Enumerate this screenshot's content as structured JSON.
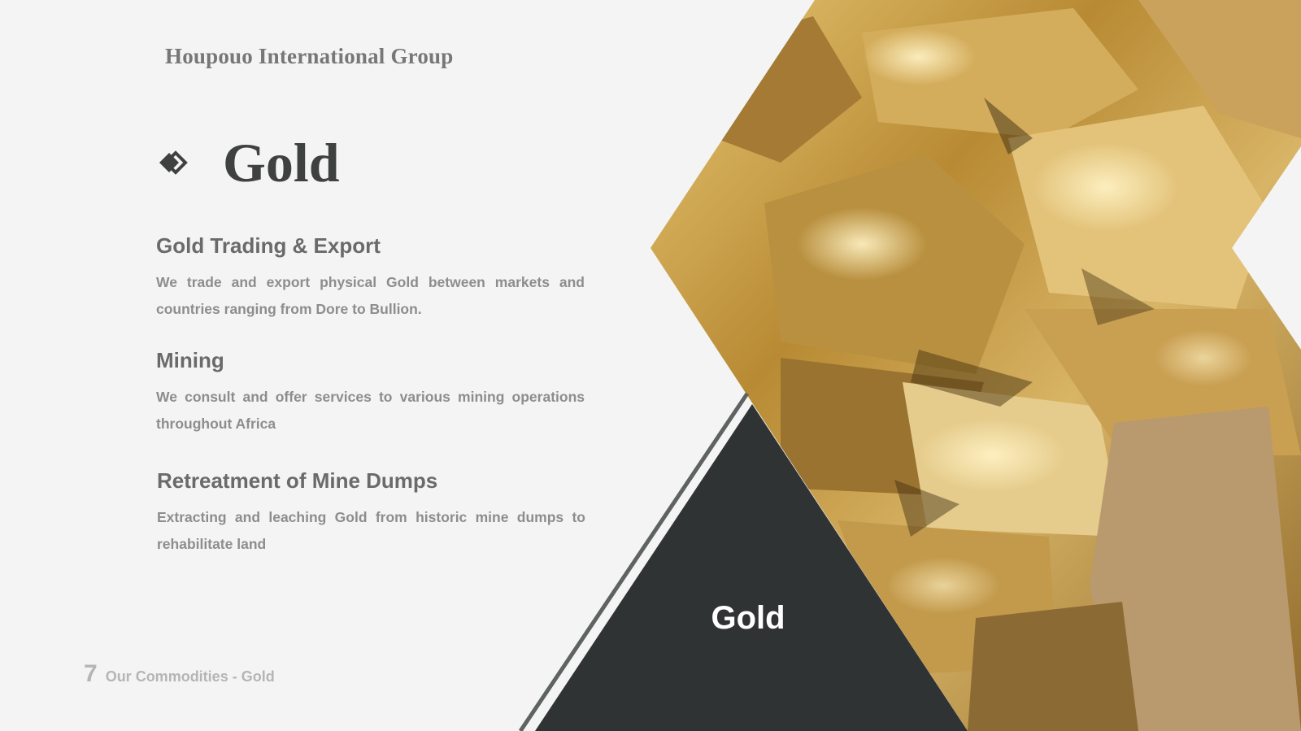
{
  "header": {
    "company": "Houpouo International Group"
  },
  "title": {
    "text": "Gold",
    "icon": "double-diamond-icon"
  },
  "sections": [
    {
      "heading": "Gold Trading & Export",
      "body": "We trade and export physical Gold between markets and countries ranging from Dore to Bullion."
    },
    {
      "heading": "Mining",
      "body": "We consult and offer services to various mining operations throughout Africa"
    },
    {
      "heading": "Retreatment of Mine Dumps",
      "body": "Extracting and leaching Gold from historic mine dumps to rehabilitate land"
    }
  ],
  "image": {
    "label": "Gold"
  },
  "footer": {
    "page_number": "7",
    "text": "Our Commodities - Gold"
  },
  "colors": {
    "dark": "#2f3333",
    "gold": "#c9a24a",
    "text": "#6a6a6a"
  }
}
